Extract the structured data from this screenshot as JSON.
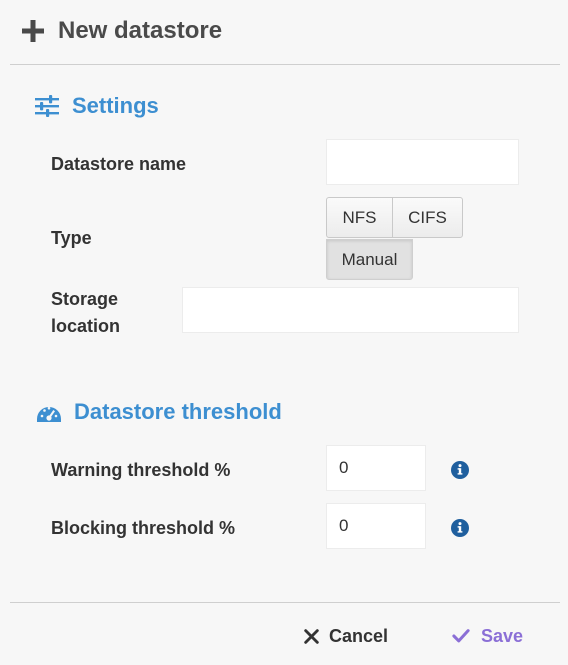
{
  "dialog": {
    "title": "New datastore",
    "title_icon": "plus-icon"
  },
  "settings": {
    "header": "Settings",
    "header_icon": "sliders-icon",
    "datastore_name": {
      "label": "Datastore name",
      "value": ""
    },
    "type": {
      "label": "Type",
      "options": [
        "NFS",
        "CIFS",
        "Manual"
      ],
      "selected": "Manual"
    },
    "storage_location": {
      "label_line1": "Storage",
      "label_line2": "location",
      "value": ""
    }
  },
  "threshold": {
    "header": "Datastore threshold",
    "header_icon": "gauge-icon",
    "warning": {
      "label": "Warning threshold %",
      "value": "0",
      "info_icon": "info-icon"
    },
    "blocking": {
      "label": "Blocking threshold %",
      "value": "0",
      "info_icon": "info-icon"
    }
  },
  "footer": {
    "cancel_label": "Cancel",
    "cancel_icon": "close-icon",
    "save_label": "Save",
    "save_icon": "check-icon"
  },
  "colors": {
    "accent": "#3d8fd1",
    "save": "#8b6fd6",
    "info": "#1f5f9e",
    "background": "#f7f7f7"
  }
}
